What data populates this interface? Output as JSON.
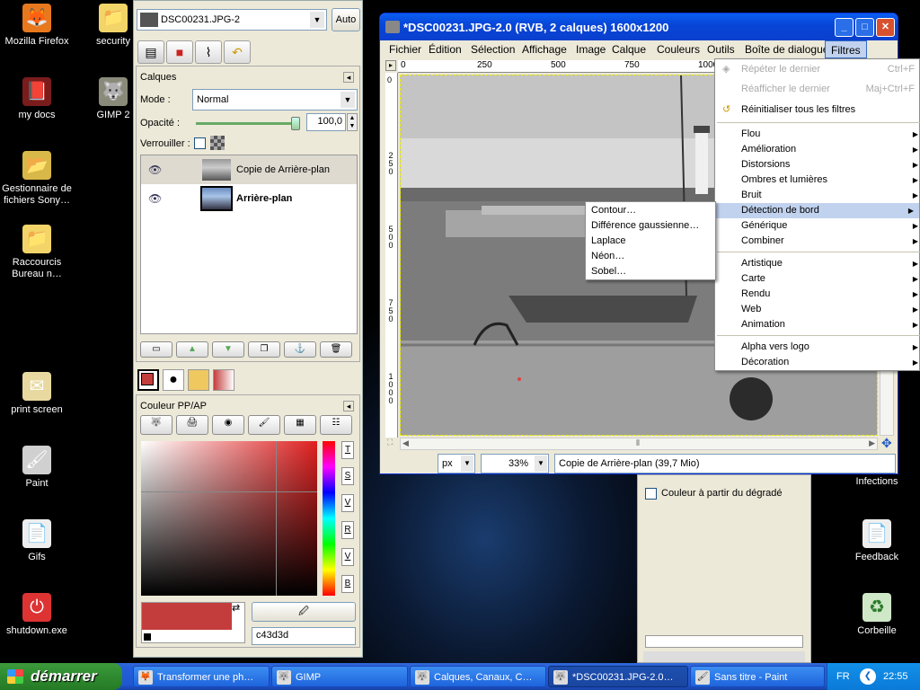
{
  "desktop": {
    "icons": [
      {
        "label": "Mozilla Firefox",
        "glyph": "🦊"
      },
      {
        "label": "security",
        "glyph": "📁"
      },
      {
        "label": "my docs",
        "glyph": "📕"
      },
      {
        "label": "GIMP 2",
        "glyph": "🐺"
      },
      {
        "label": "Gestionnaire de fichiers Sony…",
        "glyph": "📂"
      },
      {
        "label": "Raccourcis Bureau n…",
        "glyph": "📁"
      },
      {
        "label": "print screen",
        "glyph": "✉"
      },
      {
        "label": "Paint",
        "glyph": "🖌"
      },
      {
        "label": "Gifs",
        "glyph": "📄"
      },
      {
        "label": "shutdown.exe",
        "glyph": "⏻"
      },
      {
        "label": "Infections",
        "glyph": ""
      },
      {
        "label": "Feedback",
        "glyph": "📄"
      },
      {
        "label": "Corbeille",
        "glyph": "♻"
      }
    ]
  },
  "toolbox": {
    "image_select": "DSC00231.JPG-2",
    "auto_label": "Auto",
    "layers_title": "Calques",
    "mode_label": "Mode :",
    "mode_value": "Normal",
    "opacity_label": "Opacité :",
    "opacity_value": "100,0",
    "opacity_fraction": 1.0,
    "lock_label": "Verrouiller :",
    "layers": [
      {
        "name": "Copie de Arrière-plan"
      },
      {
        "name": "Arrière-plan"
      }
    ],
    "colors_title": "Couleur PP/AP",
    "spectrum_letters": [
      "T",
      "S",
      "V",
      "R",
      "V",
      "B"
    ],
    "hex_value": "c43d3d",
    "fg_color": "#c43d3d"
  },
  "image_window": {
    "title": "*DSC00231.JPG-2.0 (RVB, 2 calques) 1600x1200",
    "menu": [
      "Fichier",
      "Édition",
      "Sélection",
      "Affichage",
      "Image",
      "Calque",
      "Couleurs",
      "Outils",
      "Boîte de dialogue",
      "Filtres"
    ],
    "ruler_ticks": [
      "0",
      "250",
      "500",
      "750",
      "1000"
    ],
    "vruler_ticks": [
      "0",
      "250",
      "500",
      "750",
      "1000"
    ],
    "unit": "px",
    "zoom": "33%",
    "status": "Copie de Arrière-plan (39,7 Mio)"
  },
  "filters_menu": {
    "top": [
      {
        "label": "Répéter le dernier",
        "shortcut": "Ctrl+F",
        "disabled": true
      },
      {
        "label": "Réafficher le dernier",
        "shortcut": "Maj+Ctrl+F",
        "disabled": true
      },
      {
        "label": "Réinitialiser tous les filtres",
        "shortcut": "",
        "disabled": false
      }
    ],
    "group1": [
      "Flou",
      "Amélioration",
      "Distorsions",
      "Ombres et lumières",
      "Bruit",
      "Détection de bord",
      "Générique",
      "Combiner"
    ],
    "group2": [
      "Artistique",
      "Carte",
      "Rendu",
      "Web",
      "Animation"
    ],
    "group3": [
      "Alpha vers logo",
      "Décoration"
    ],
    "highlighted": "Détection de bord"
  },
  "edge_submenu": [
    "Contour…",
    "Différence gaussienne…",
    "Laplace",
    "Néon…",
    "Sobel…"
  ],
  "gradient_panel": {
    "checkbox_label": "Couleur à partir du dégradé"
  },
  "taskbar": {
    "start": "démarrer",
    "tasks": [
      "Transformer une ph…",
      "GIMP",
      "Calques, Canaux, C…",
      "*DSC00231.JPG-2.0…",
      "Sans titre - Paint"
    ],
    "lang": "FR",
    "clock": "22:55"
  }
}
